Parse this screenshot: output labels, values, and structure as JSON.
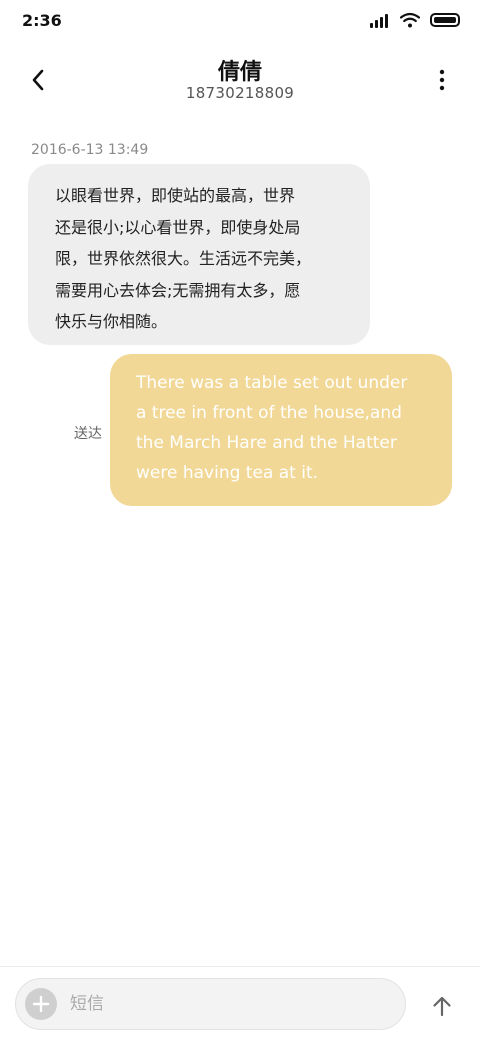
{
  "status_bar": {
    "time": "2:36",
    "icons": [
      "signal-icon",
      "wifi-icon",
      "battery-icon"
    ]
  },
  "header": {
    "contact_name": "倩倩",
    "phone_number": "18730218809",
    "back_icon": "chevron-left-icon",
    "more_icon": "more-vertical-icon"
  },
  "conversation": {
    "timestamp": "2016-6-13 13:49",
    "messages": [
      {
        "direction": "incoming",
        "lines": [
          "以眼看世界，即使站的最高，世界",
          "还是很小;以心看世界，即使身处局",
          "限，世界依然很大。生活远不完美，",
          "需要用心去体会;无需拥有太多，愿",
          "快乐与你相随。"
        ]
      },
      {
        "direction": "outgoing",
        "status": "送达",
        "lines": [
          "There was a table set out under",
          "a tree in front of the house,and",
          "the March Hare and the Hatter",
          "were having tea at it."
        ]
      }
    ]
  },
  "composer": {
    "placeholder": "短信",
    "value": "",
    "add_icon": "plus-icon",
    "send_icon": "arrow-up-icon"
  },
  "colors": {
    "incoming_bubble": "#eeeeee",
    "outgoing_bubble": "#f2d896",
    "outgoing_text": "#ffffff"
  }
}
